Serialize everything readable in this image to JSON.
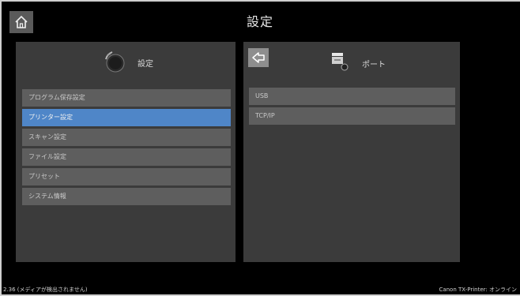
{
  "header": {
    "title": "設定",
    "home_icon": "home-icon"
  },
  "left_panel": {
    "title": "設定",
    "icon": "settings-dial-icon",
    "items": [
      {
        "label": "プログラム保存設定",
        "selected": false
      },
      {
        "label": "プリンター設定",
        "selected": true
      },
      {
        "label": "スキャン設定",
        "selected": false
      },
      {
        "label": "ファイル設定",
        "selected": false
      },
      {
        "label": "プリセット",
        "selected": false
      },
      {
        "label": "システム情報",
        "selected": false
      }
    ]
  },
  "right_panel": {
    "title": "ポート",
    "icon": "printer-port-icon",
    "back_icon": "back-arrow-icon",
    "items": [
      {
        "label": "USB"
      },
      {
        "label": "TCP/IP"
      }
    ]
  },
  "status": {
    "left": "2.36 (メディアが検出されません)",
    "right": "Canon TX-Printer: オンライン"
  },
  "colors": {
    "selected": "#4f86c8",
    "panel": "#3b3b3b",
    "item": "#5e5e5e",
    "background": "#000000"
  }
}
